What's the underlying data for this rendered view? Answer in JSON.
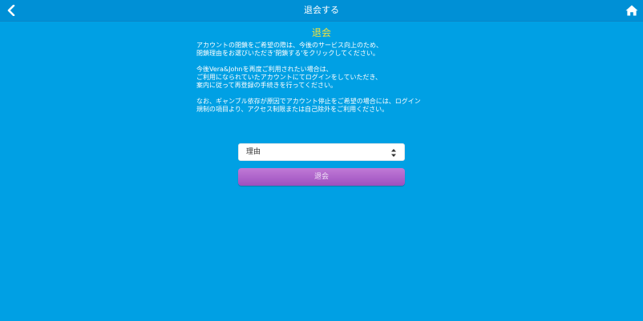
{
  "header": {
    "title": "退会する",
    "back_icon": "chevron-left-icon",
    "home_icon": "home-icon"
  },
  "main": {
    "title": "退会",
    "paragraphs": [
      [
        "アカウントの閉鎖をご希望の際は、今後のサービス向上のため、",
        "閉鎖理由をお選びいただき'閉鎖する'をクリックしてください。"
      ],
      [
        "今後Vera&Johnを再度ご利用されたい場合は、",
        "ご利用になられていたアカウントにてログインをしていただき、",
        "案内に従って再登録の手続きを行ってください。"
      ],
      [
        "なお、ギャンブル依存が原因でアカウント停止をご希望の場合には、ログイン",
        "規制の項目より、アクセス制限または自己除外をご利用ください。"
      ]
    ]
  },
  "form": {
    "reason_select": {
      "selected": "理由"
    },
    "submit_label": "退会"
  },
  "colors": {
    "background": "#00a0e4",
    "header": "#0090d6",
    "title": "#f4e23c",
    "button": "#9d4fbf"
  }
}
